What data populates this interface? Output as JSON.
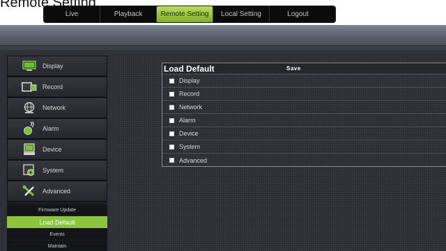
{
  "header": {
    "title_partial": "Remote Setting"
  },
  "tabs": [
    {
      "label": "Live",
      "active": false
    },
    {
      "label": "Playback",
      "active": false
    },
    {
      "label": "Remote Setting",
      "active": true
    },
    {
      "label": "Local Setting",
      "active": false
    },
    {
      "label": "Logout",
      "active": false
    }
  ],
  "sidebar": {
    "menu": [
      {
        "label": "Display",
        "icon": "monitor-icon"
      },
      {
        "label": "Record",
        "icon": "record-icon"
      },
      {
        "label": "Network",
        "icon": "network-icon"
      },
      {
        "label": "Alarm",
        "icon": "alarm-icon"
      },
      {
        "label": "Device",
        "icon": "device-icon"
      },
      {
        "label": "System",
        "icon": "system-icon"
      },
      {
        "label": "Advanced",
        "icon": "tools-icon"
      }
    ],
    "submenu": [
      {
        "label": "Firmware Update",
        "active": false
      },
      {
        "label": "Load Default",
        "active": true
      },
      {
        "label": "Events",
        "active": false
      },
      {
        "label": "Maintain",
        "active": false
      }
    ]
  },
  "panel": {
    "title": "Load Default",
    "save_label": "Save",
    "options": [
      "Display",
      "Record",
      "Network",
      "Alarm",
      "Device",
      "System",
      "Advanced"
    ]
  },
  "colors": {
    "accent": "#8cc63f",
    "background": "#2f3238"
  }
}
